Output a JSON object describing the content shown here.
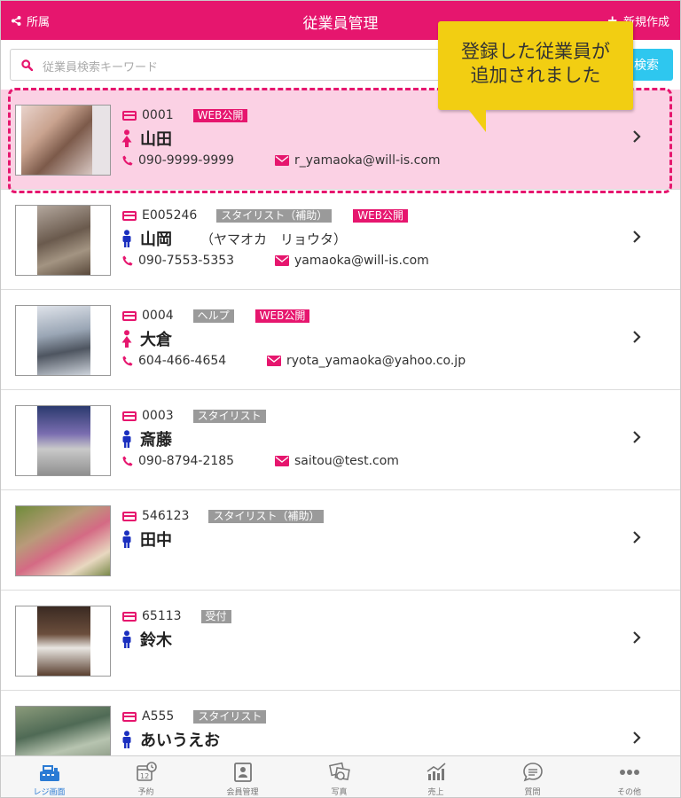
{
  "header": {
    "left_label": "所属",
    "title": "従業員管理",
    "right_label": "新規作成",
    "color": "#e6166e"
  },
  "search": {
    "placeholder": "従業員検索キーワード",
    "button_label": "検索",
    "button_color": "#2ec7ef"
  },
  "tooltip": {
    "line1": "登録した従業員が",
    "line2": "追加されました",
    "color": "#f2ce12"
  },
  "employees": [
    {
      "code": "0001",
      "tags": [
        {
          "label": "WEB公開",
          "type": "pink"
        }
      ],
      "gender": "female",
      "name": "山田",
      "kana": "",
      "phone": "090-9999-9999",
      "email": "r_yamaoka@will-is.com",
      "highlight": true
    },
    {
      "code": "E005246",
      "tags": [
        {
          "label": "スタイリスト（補助）",
          "type": "gray"
        },
        {
          "label": "WEB公開",
          "type": "pink"
        }
      ],
      "gender": "male",
      "name": "山岡",
      "kana": "（ヤマオカ　リョウタ）",
      "phone": "090-7553-5353",
      "email": "yamaoka@will-is.com"
    },
    {
      "code": "0004",
      "tags": [
        {
          "label": "ヘルプ",
          "type": "gray"
        },
        {
          "label": "WEB公開",
          "type": "pink"
        }
      ],
      "gender": "female",
      "name": "大倉",
      "kana": "",
      "phone": "604-466-4654",
      "email": "ryota_yamaoka@yahoo.co.jp"
    },
    {
      "code": "0003",
      "tags": [
        {
          "label": "スタイリスト",
          "type": "gray"
        }
      ],
      "gender": "male",
      "name": "斎藤",
      "kana": "",
      "phone": "090-8794-2185",
      "email": "saitou@test.com"
    },
    {
      "code": "546123",
      "tags": [
        {
          "label": "スタイリスト（補助）",
          "type": "gray"
        }
      ],
      "gender": "male",
      "name": "田中",
      "kana": "",
      "phone": "",
      "email": ""
    },
    {
      "code": "65113",
      "tags": [
        {
          "label": "受付",
          "type": "gray"
        }
      ],
      "gender": "male",
      "name": "鈴木",
      "kana": "",
      "phone": "",
      "email": ""
    },
    {
      "code": "A555",
      "tags": [
        {
          "label": "スタイリスト",
          "type": "gray"
        }
      ],
      "gender": "male",
      "name": "あいうえお",
      "kana": "",
      "phone": "",
      "email": ""
    }
  ],
  "tabbar": {
    "items": [
      {
        "label": "レジ画面",
        "icon": "register-icon",
        "active": true
      },
      {
        "label": "予約",
        "icon": "calendar-clock-icon"
      },
      {
        "label": "会員管理",
        "icon": "member-card-icon"
      },
      {
        "label": "写真",
        "icon": "photo-icon"
      },
      {
        "label": "売上",
        "icon": "sales-chart-icon"
      },
      {
        "label": "質問",
        "icon": "chat-bubble-icon"
      },
      {
        "label": "その他",
        "icon": "more-dots-icon"
      }
    ]
  }
}
